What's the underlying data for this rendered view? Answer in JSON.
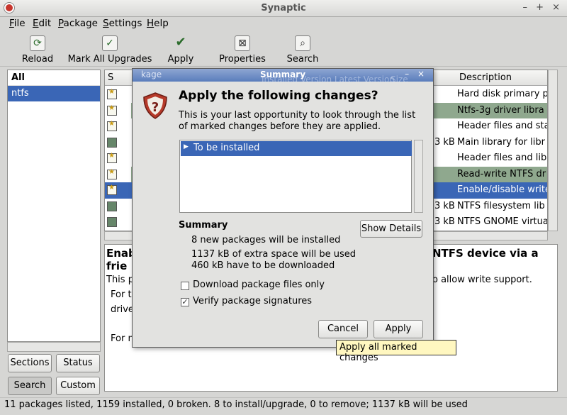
{
  "window": {
    "title": "Synaptic",
    "controls": "– + ×"
  },
  "menu": [
    "File",
    "Edit",
    "Package",
    "Settings",
    "Help"
  ],
  "toolbar": {
    "reload": "Reload",
    "mark_all": "Mark All Upgrades",
    "apply": "Apply",
    "properties": "Properties",
    "search": "Search"
  },
  "left_panel": {
    "header": "All",
    "items": [
      "ntfs"
    ],
    "buttons": {
      "sections": "Sections",
      "status": "Status",
      "search": "Search",
      "custom": "Custom"
    }
  },
  "package_table": {
    "columns": {
      "s": "S",
      "description": "Description"
    },
    "rows": [
      {
        "status": "star",
        "size": "",
        "description": "Hard disk primary p"
      },
      {
        "status": "star",
        "size": "",
        "description": "Ntfs-3g driver libra"
      },
      {
        "status": "star",
        "size": "",
        "description": "Header files and sta"
      },
      {
        "status": "marked",
        "size": "3 kB",
        "description": "Main library for libr"
      },
      {
        "status": "star",
        "size": "",
        "description": "Header files and lib"
      },
      {
        "status": "star",
        "size": "",
        "description": "Read-write NTFS dr"
      },
      {
        "status": "star",
        "size": "",
        "description": "Enable/disable write"
      },
      {
        "status": "marked",
        "size": "3 kB",
        "description": "NTFS filesystem lib"
      },
      {
        "status": "marked",
        "size": "3 kB",
        "description": "NTFS GNOME virtua"
      }
    ]
  },
  "description_pane": {
    "heading_left_1": "Enab",
    "heading_left_2": "frie",
    "heading_right": "NTFS device via a",
    "line1_left": "This p",
    "line1_right": "o allow write support.",
    "line2": "For th",
    "line3": "drive",
    "line4": "For m"
  },
  "status_bar": "11 packages listed, 1159 installed, 0 broken. 8 to install/upgrade, 0 to remove; 1137 kB will be used",
  "dialog": {
    "title": "Summary",
    "header_behind": "kage",
    "header_behind_2": "Installed Version  Latest Version",
    "header_behind_3": "Size",
    "heading": "Apply the following changes?",
    "text": "This is your last opportunity to look through the list of marked changes before they are applied.",
    "list_item": "To be installed",
    "summary_label": "Summary",
    "show_details": "Show Details",
    "summary_lines": [
      "8 new packages will be installed",
      "1137 kB of extra space will be used",
      "460 kB have to be downloaded"
    ],
    "download_only": {
      "label": "Download package files only",
      "checked": false
    },
    "verify_signatures": {
      "label": "Verify package signatures",
      "checked": true
    },
    "cancel": "Cancel",
    "apply": "Apply"
  },
  "tooltip": "Apply all marked changes"
}
